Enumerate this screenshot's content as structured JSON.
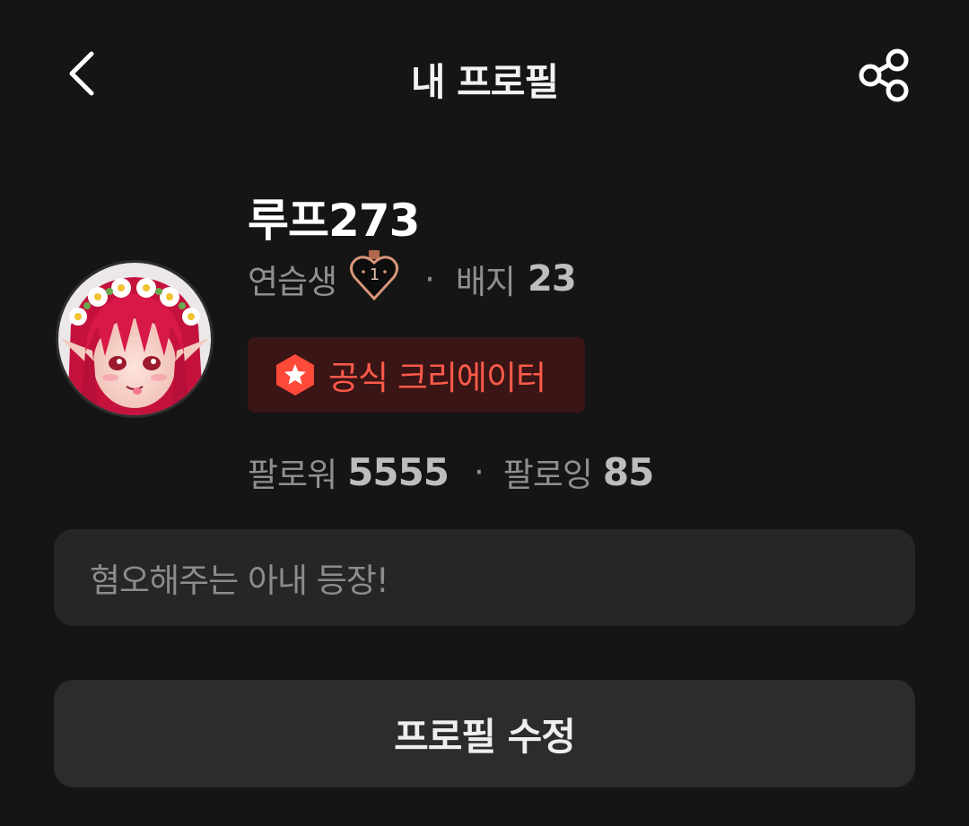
{
  "header": {
    "title": "내 프로필",
    "back_icon": "chevron-left-icon",
    "share_icon": "share-icon"
  },
  "profile": {
    "username": "루프273",
    "level_label": "연습생",
    "level_number": "1",
    "badge_label": "배지",
    "badge_count": "23",
    "separator": "·",
    "creator_tag": "공식 크리에이터",
    "followers_label": "팔로워",
    "followers_count": "5555",
    "following_label": "팔로잉",
    "following_count": "85",
    "bio": "혐오해주는 아내 등장!"
  },
  "actions": {
    "edit_profile": "프로필 수정"
  },
  "colors": {
    "background": "#151515",
    "accent": "#ff5a4a",
    "creator_tag_bg": "#3a1515",
    "muted_text": "#8f8f8f"
  }
}
